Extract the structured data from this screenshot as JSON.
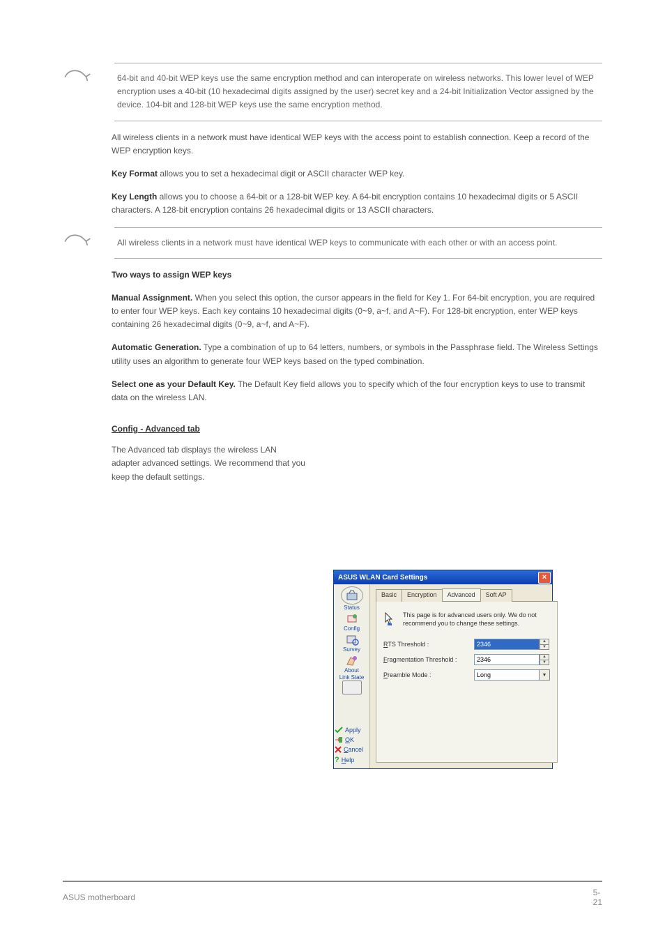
{
  "notes": {
    "n1": "64-bit and 40-bit WEP keys use the same encryption method and can interoperate on wireless networks. This lower level of WEP encryption uses a 40-bit (10 hexadecimal digits assigned by the user) secret key and a 24-bit Initialization Vector assigned by the device. 104-bit and 128-bit WEP keys use the same encryption method.",
    "n2": "All wireless clients in a network must have identical WEP keys to communicate with each other or with an access point."
  },
  "paras": {
    "p1": "All wireless clients in a network must have identical WEP keys with the access point to establish connection. Keep a record of the WEP encryption keys.",
    "p2_label": "Key Format",
    "p2": " allows you to set a hexadecimal digit or ASCII character WEP key.",
    "p3_label": "Key Length",
    "p3": " allows you to choose a 64-bit or a 128-bit WEP key. A 64-bit encryption contains 10 hexadecimal digits or 5 ASCII characters. A 128-bit encryption contains 26 hexadecimal digits or 13 ASCII characters.",
    "p4_label": "Two ways to assign WEP keys",
    "p5_label": "Manual Assignment.",
    "p5": " When you select this option, the cursor appears in the field for Key 1. For 64-bit encryption, you are required to enter four WEP keys. Each key contains 10 hexadecimal digits (0~9, a~f, and A~F). For 128-bit encryption, enter WEP keys containing 26 hexadecimal digits (0~9, a~f, and A~F).",
    "p6_label": "Automatic Generation.",
    "p6": " Type a combination of up to 64 letters, numbers, or symbols in the Passphrase field. The Wireless Settings utility uses an algorithm to generate four WEP keys based on the typed combination.",
    "p7_label": "Select one as your Default Key.",
    "p7": " The Default Key field allows you to specify which of the four encryption keys to use to transmit data on the wireless LAN."
  },
  "section": {
    "title": "Config - Advanced tab",
    "intro": "The Advanced tab displays the wireless LAN adapter advanced settings. We recommend that you keep the default settings."
  },
  "dialog": {
    "title": "ASUS WLAN Card Settings",
    "sidebar": {
      "status": "Status",
      "config": "Config",
      "survey": "Survey",
      "about": "About",
      "linkstate": "Link State"
    },
    "actions": {
      "apply": "Apply",
      "ok": "OK",
      "cancel": "Cancel",
      "help": "Help"
    },
    "tabs": {
      "basic": "Basic",
      "encryption": "Encryption",
      "advanced": "Advanced",
      "softap": "Soft AP"
    },
    "info": "This page is for advanced users only. We do not recommend you to change these settings.",
    "form": {
      "rts_label": "RTS Threshold :",
      "rts_value": "2346",
      "frag_label": "Fragmentation Threshold :",
      "frag_value": "2346",
      "preamble_label": "Preamble Mode :",
      "preamble_value": "Long"
    }
  },
  "footer": {
    "left": "ASUS motherboard",
    "right": "5-21"
  }
}
